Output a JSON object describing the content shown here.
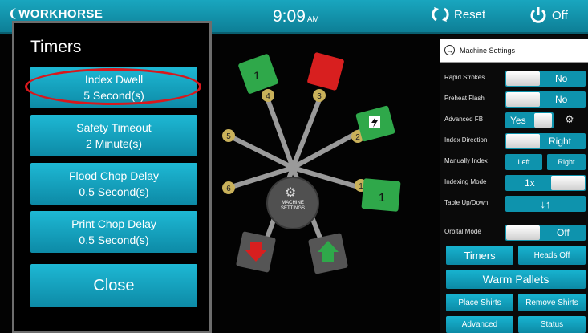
{
  "topbar": {
    "logo": "WORKHORSE",
    "time": "9:09",
    "ampm": "AM",
    "reset_label": "Reset",
    "off_label": "Off"
  },
  "timers_panel": {
    "title": "Timers",
    "buttons": [
      {
        "label": "Index Dwell",
        "value": "5 Second(s)"
      },
      {
        "label": "Safety Timeout",
        "value": "2 Minute(s)"
      },
      {
        "label": "Flood Chop Delay",
        "value": "0.5 Second(s)"
      },
      {
        "label": "Print Chop Delay",
        "value": "0.5 Second(s)"
      }
    ],
    "close_label": "Close"
  },
  "press": {
    "hub_line1": "MACHINE",
    "hub_line2": "SETTINGS",
    "heads": [
      {
        "number": "1",
        "pallet": "1",
        "color": "#2fa84a"
      },
      {
        "number": "2",
        "pallet": "",
        "color": "#2fa84a"
      },
      {
        "number": "3",
        "pallet": "",
        "color": "#d81f1f"
      },
      {
        "number": "4",
        "pallet": "1",
        "color": "#2fa84a"
      },
      {
        "number": "5",
        "pallet": "",
        "color": "#2fa84a"
      },
      {
        "number": "6",
        "pallet": "",
        "color": "#2fa84a"
      }
    ]
  },
  "machine_settings": {
    "header": "Machine Settings",
    "rows": {
      "rapid_strokes": {
        "label": "Rapid Strokes",
        "value": "No"
      },
      "preheat_flash": {
        "label": "Preheat Flash",
        "value": "No"
      },
      "advanced_fb": {
        "label": "Advanced FB",
        "value": "Yes"
      },
      "index_direction": {
        "label": "Index Direction",
        "value": "Right"
      },
      "manually_index": {
        "label": "Manually Index",
        "left": "Left",
        "right": "Right"
      },
      "indexing_mode": {
        "label": "Indexing Mode",
        "value": "1x"
      },
      "table_updown": {
        "label": "Table Up/Down",
        "value": "↓↑"
      },
      "orbital_mode": {
        "label": "Orbital Mode",
        "value": "Off"
      }
    },
    "buttons": {
      "timers": "Timers",
      "heads_off": "Heads Off",
      "warm_pallets": "Warm Pallets",
      "place_shirts": "Place Shirts",
      "remove_shirts": "Remove Shirts",
      "advanced": "Advanced",
      "status": "Status"
    }
  },
  "colors": {
    "accent": "#14a3bf",
    "highlight_oval": "#d8181d"
  }
}
